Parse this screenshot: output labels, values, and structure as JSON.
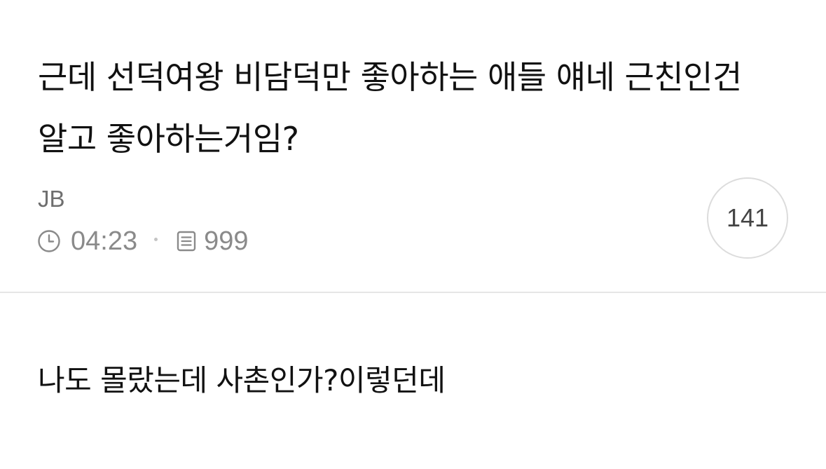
{
  "post": {
    "title": "근데 선덕여왕 비담덕만 좋아하는 애들 얘네 근친인건 알고 좋아하는거임?",
    "author": "JB",
    "time": "04:23",
    "views": "999",
    "comment_count": "141",
    "body": "나도 몰랐는데 사촌인가?이렇던데"
  },
  "icons": {
    "time": "clock-icon",
    "views": "document-icon"
  },
  "colors": {
    "text": "#111111",
    "meta": "#8a8a8a",
    "badge_border": "#dcdcdc",
    "divider": "#e6e6e6"
  }
}
